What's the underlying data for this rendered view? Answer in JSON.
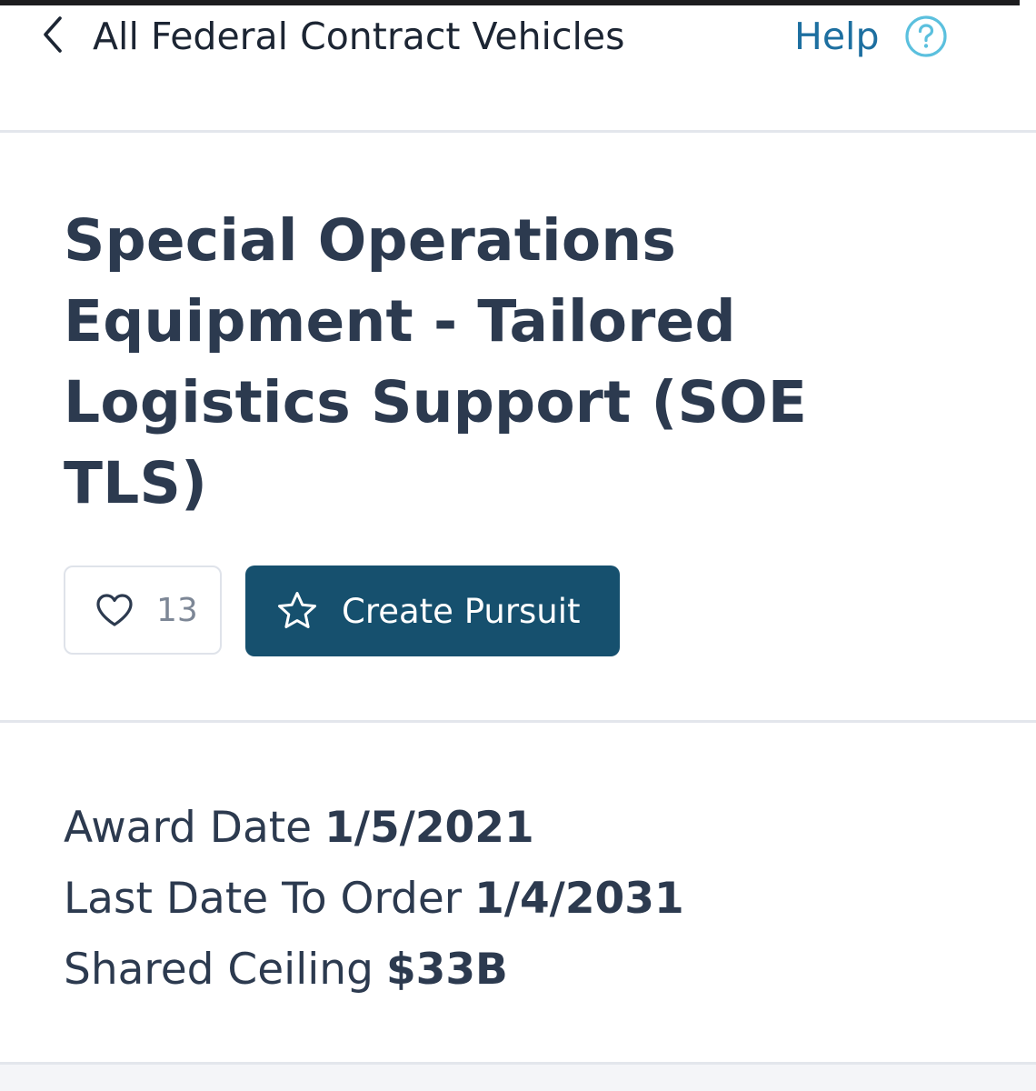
{
  "header": {
    "back_icon": "chevron-left-icon",
    "title": "All Federal Contract Vehicles",
    "help_label": "Help",
    "help_icon": "question-circle-icon"
  },
  "vehicle": {
    "title": "Special Operations Equipment - Tailored Logistics Support (SOE TLS)"
  },
  "actions": {
    "like_icon": "heart-icon",
    "like_count": "13",
    "pursuit_icon": "star-icon",
    "pursuit_label": "Create Pursuit"
  },
  "details": [
    {
      "label": "Award Date",
      "value": "1/5/2021"
    },
    {
      "label": "Last Date To Order",
      "value": "1/4/2031"
    },
    {
      "label": "Shared Ceiling",
      "value": "$33B"
    }
  ],
  "colors": {
    "primary_button": "#16506e",
    "help_link": "#1d6fa0",
    "help_icon": "#5bc0de",
    "title_text": "#2c3a4f"
  }
}
